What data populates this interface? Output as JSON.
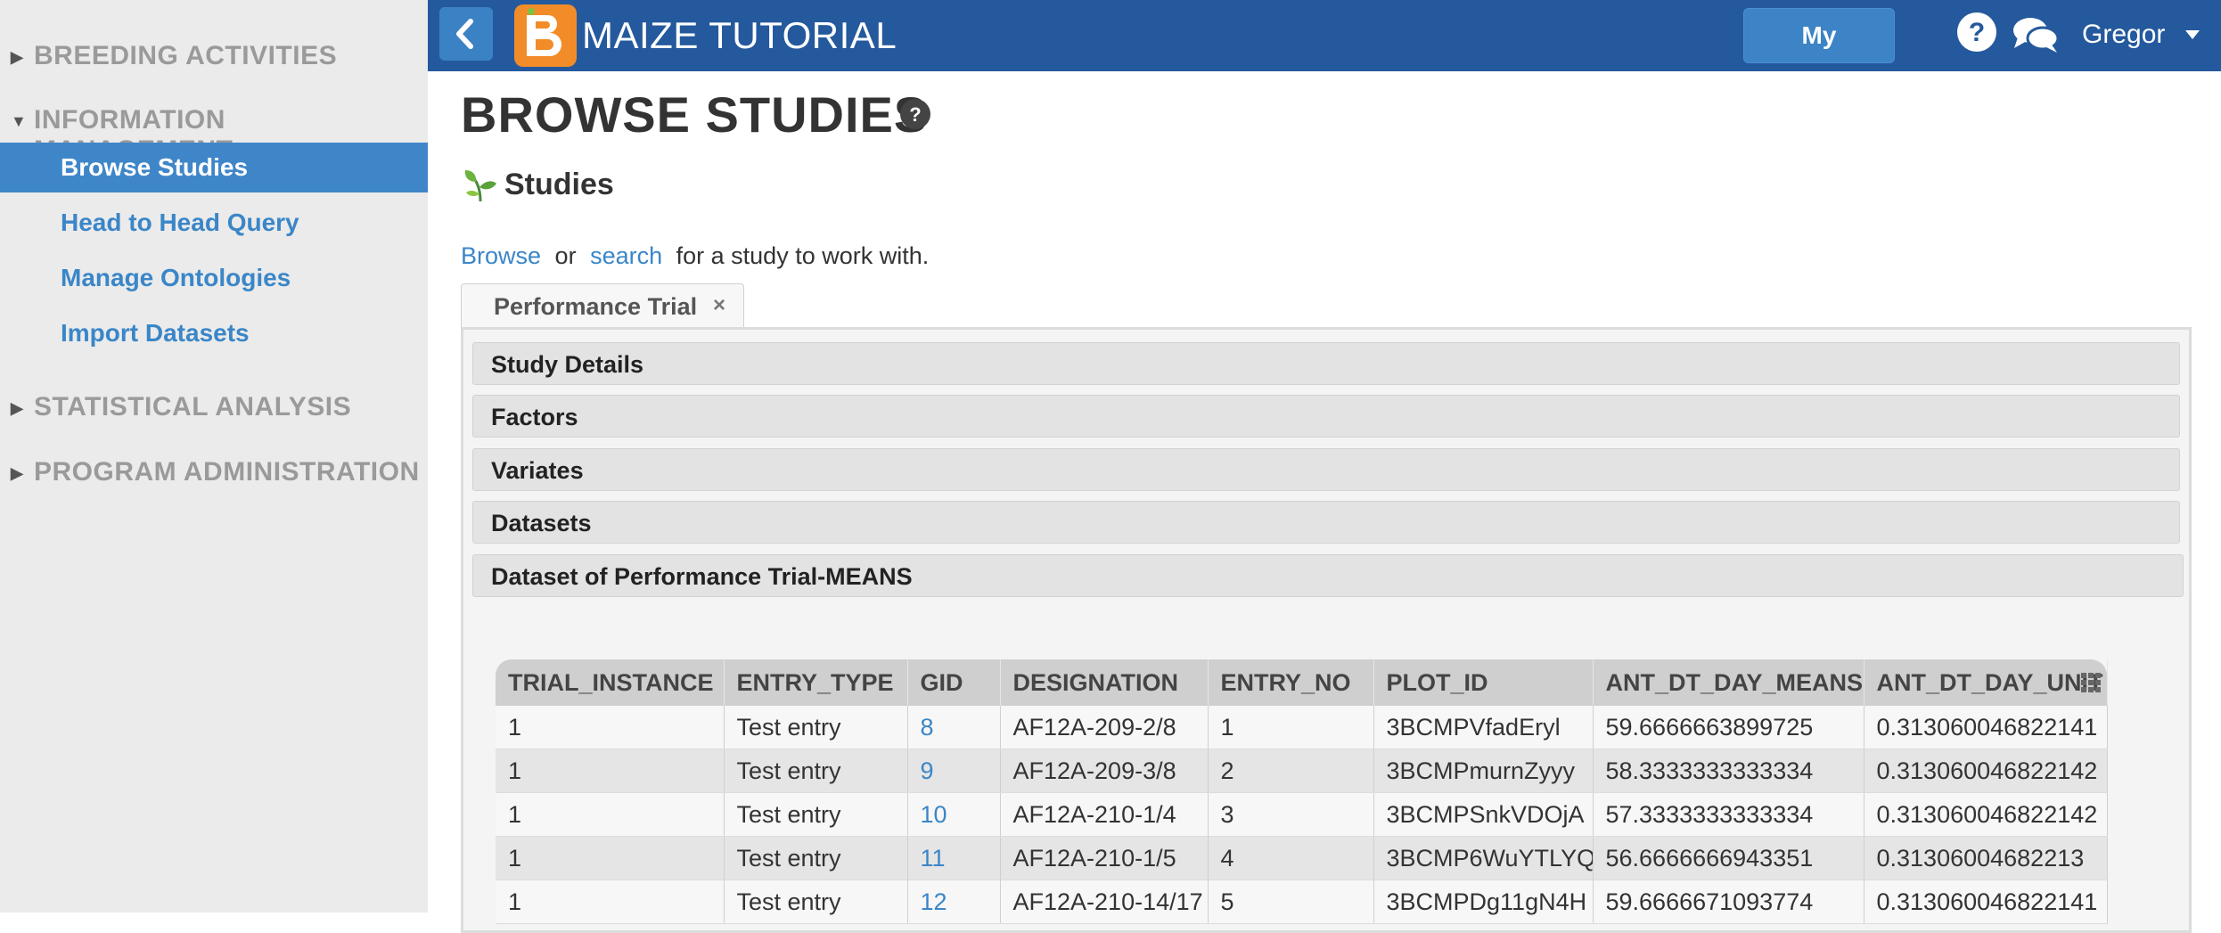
{
  "sidebar": {
    "sections": [
      {
        "label": "BREEDING ACTIVITIES",
        "expanded": false
      },
      {
        "label": "INFORMATION MANAGEMENT",
        "expanded": true
      },
      {
        "label": "STATISTICAL ANALYSIS",
        "expanded": false
      },
      {
        "label": "PROGRAM ADMINISTRATION",
        "expanded": false
      }
    ],
    "items": [
      {
        "label": "Browse Studies",
        "active": true
      },
      {
        "label": "Head to Head Query",
        "active": false
      },
      {
        "label": "Manage Ontologies",
        "active": false
      },
      {
        "label": "Import Datasets",
        "active": false
      }
    ]
  },
  "topbar": {
    "title": "MAIZE TUTORIAL",
    "my_programs_label": "My Programs",
    "user_name": "Gregor",
    "icons": [
      "back-arrow-icon",
      "app-logo-icon",
      "help-icon",
      "chat-icon",
      "caret-down-icon"
    ]
  },
  "main": {
    "page_title": "BROWSE STUDIES",
    "section_heading": "Studies",
    "intro": {
      "browse_link": "Browse",
      "or_text": "or",
      "search_link": "search",
      "rest_text": "for a study to work with."
    },
    "open_tab": {
      "label": "Performance Trial",
      "close_glyph": "×"
    },
    "accordions": [
      "Study Details",
      "Factors",
      "Variates",
      "Datasets",
      "Dataset of Performance Trial-MEANS"
    ]
  },
  "table": {
    "columns": [
      "TRIAL_INSTANCE",
      "ENTRY_TYPE",
      "GID",
      "DESIGNATION",
      "ENTRY_NO",
      "PLOT_ID",
      "ANT_DT_DAY_MEANS",
      "ANT_DT_DAY_UNIT"
    ],
    "rows": [
      [
        "1",
        "Test entry",
        "8",
        "AF12A-209-2/8",
        "1",
        "3BCMPVfadEryl",
        "59.6666663899725",
        "0.313060046822141"
      ],
      [
        "1",
        "Test entry",
        "9",
        "AF12A-209-3/8",
        "2",
        "3BCMPmurnZyyy",
        "58.3333333333334",
        "0.313060046822142"
      ],
      [
        "1",
        "Test entry",
        "10",
        "AF12A-210-1/4",
        "3",
        "3BCMPSnkVDOjA",
        "57.3333333333334",
        "0.313060046822142"
      ],
      [
        "1",
        "Test entry",
        "11",
        "AF12A-210-1/5",
        "4",
        "3BCMP6WuYTLYQ",
        "56.6666666943351",
        "0.31306004682213"
      ],
      [
        "1",
        "Test entry",
        "12",
        "AF12A-210-14/17",
        "5",
        "3BCMPDg11gN4H",
        "59.6666671093774",
        "0.313060046822141"
      ]
    ]
  },
  "colors": {
    "topbar": "#24599d",
    "accent": "#3f86c9",
    "link": "#3a86c8",
    "logo": "#f28c28",
    "sidebar_bg": "#ebebeb"
  }
}
